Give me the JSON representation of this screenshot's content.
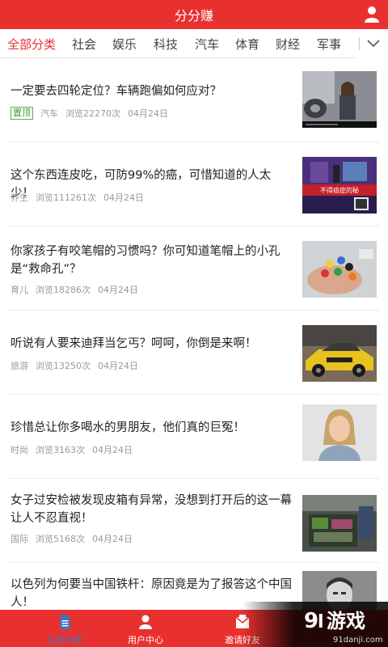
{
  "header": {
    "title": "分分赚"
  },
  "tabs": [
    {
      "label": "全部分类"
    },
    {
      "label": "社会"
    },
    {
      "label": "娱乐"
    },
    {
      "label": "科技"
    },
    {
      "label": "汽车"
    },
    {
      "label": "体育"
    },
    {
      "label": "财经"
    },
    {
      "label": "军事"
    }
  ],
  "articles": [
    {
      "title": "一定要去四轮定位？车辆跑偏如何应对？",
      "badge": "置顶",
      "category": "汽车",
      "views": "浏览22270次",
      "date": "04月24日",
      "thumb_icon": "car-video-thumb"
    },
    {
      "title": "这个东西连皮吃，可防99%的癌，可惜知道的人太少！",
      "category": "养生",
      "views": "浏览111261次",
      "date": "04月24日",
      "thumb_icon": "tv-program-thumb",
      "thumb_caption": "不得癌症的秘"
    },
    {
      "title": "你家孩子有咬笔帽的习惯吗？你可知道笔帽上的小孔是“救命孔”？",
      "category": "育儿",
      "views": "浏览18286次",
      "date": "04月24日",
      "thumb_icon": "pen-caps-thumb"
    },
    {
      "title": "听说有人要来迪拜当乞丐？呵呵，你倒是来啊！",
      "category": "旅游",
      "views": "浏览13250次",
      "date": "04月24日",
      "thumb_icon": "taxi-car-thumb"
    },
    {
      "title": "珍惜总让你多喝水的男朋友，他们真的巨冤！",
      "category": "时尚",
      "views": "浏览3163次",
      "date": "04月24日",
      "thumb_icon": "woman-portrait-thumb"
    },
    {
      "title": "女子过安检被发现皮箱有异常，没想到打开后的这一幕让人不忍直视！",
      "category": "国际",
      "views": "浏览5168次",
      "date": "04月24日",
      "thumb_icon": "suitcase-thumb"
    },
    {
      "title": "以色列为何要当中国铁杆：原因竟是为了报答这个中国人！",
      "category": "",
      "views": "",
      "date": "",
      "thumb_icon": "man-portrait-thumb"
    }
  ],
  "tabbar": [
    {
      "label": "文章列表",
      "icon": "document-icon"
    },
    {
      "label": "用户中心",
      "icon": "user-icon"
    },
    {
      "label": "邀请好友",
      "icon": "envelope-icon"
    }
  ],
  "watermark": {
    "text": "游戏",
    "site": "91danji.com"
  },
  "colors": {
    "accent": "#e8312f",
    "badge": "#3a9a3a",
    "meta": "#999999"
  }
}
